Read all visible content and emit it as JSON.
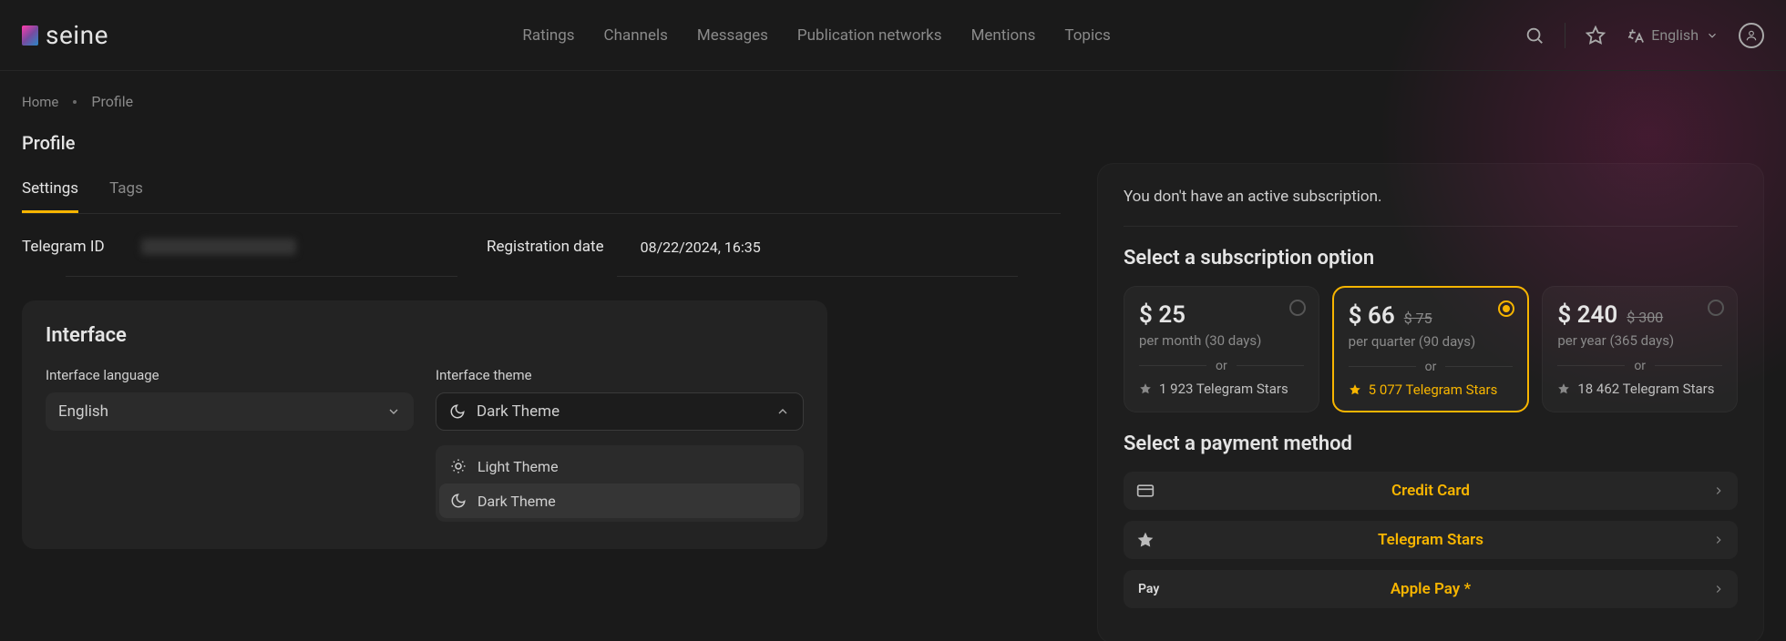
{
  "brand": "seine",
  "nav": {
    "ratings": "Ratings",
    "channels": "Channels",
    "messages": "Messages",
    "pubnet": "Publication networks",
    "mentions": "Mentions",
    "topics": "Topics"
  },
  "header_lang": "English",
  "breadcrumbs": {
    "home": "Home",
    "current": "Profile"
  },
  "page_title": "Profile",
  "tabs": {
    "settings": "Settings",
    "tags": "Tags"
  },
  "details": {
    "telegram_id_label": "Telegram ID",
    "reg_date_label": "Registration date",
    "reg_date_value": "08/22/2024, 16:35"
  },
  "interface": {
    "heading": "Interface",
    "lang_label": "Interface language",
    "lang_value": "English",
    "theme_label": "Interface theme",
    "theme_value": "Dark Theme",
    "theme_options": {
      "light": "Light Theme",
      "dark": "Dark Theme"
    }
  },
  "subscription": {
    "notice": "You don't have an active subscription.",
    "select_heading": "Select a subscription option",
    "or": "or",
    "plans": [
      {
        "price": "$ 25",
        "old": "",
        "period": "per month (30 days)",
        "stars": "1 923 Telegram Stars",
        "selected": false
      },
      {
        "price": "$ 66",
        "old": "$ 75",
        "period": "per quarter (90 days)",
        "stars": "5 077 Telegram Stars",
        "selected": true
      },
      {
        "price": "$ 240",
        "old": "$ 300",
        "period": "per year (365 days)",
        "stars": "18 462 Telegram Stars",
        "selected": false
      }
    ],
    "payment_heading": "Select a payment method",
    "methods": {
      "credit_card": "Credit Card",
      "telegram_stars": "Telegram Stars",
      "apple_pay": "Apple Pay *",
      "apple_pay_mark": "Pay"
    }
  }
}
